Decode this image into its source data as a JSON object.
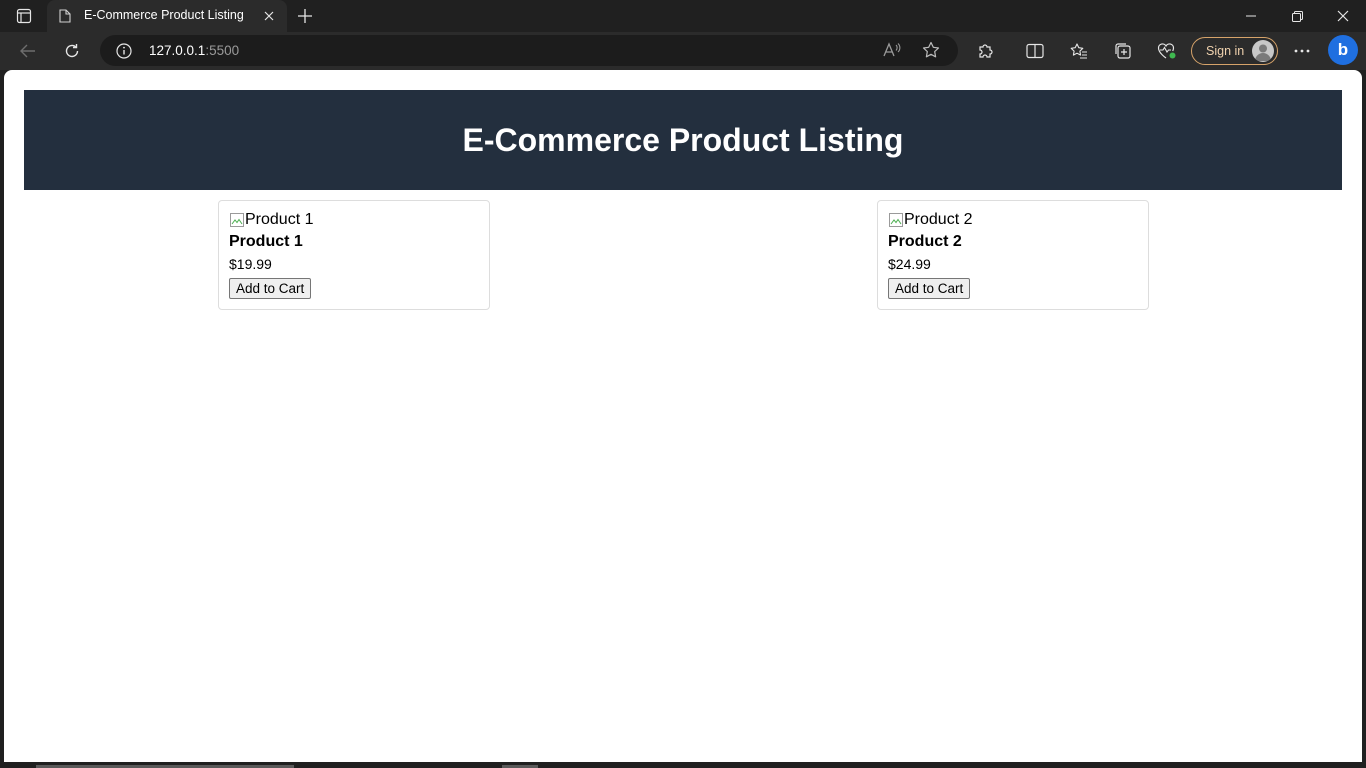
{
  "browser": {
    "tab_title": "E-Commerce Product Listing",
    "address": {
      "host": "127.0.0.1",
      "port": ":5500"
    },
    "sign_in_label": "Sign in",
    "bing_label": "b"
  },
  "page": {
    "heading": "E-Commerce Product Listing",
    "products": [
      {
        "image_alt": "Product 1",
        "name": "Product 1",
        "price": "$19.99",
        "button_label": "Add to Cart"
      },
      {
        "image_alt": "Product 2",
        "name": "Product 2",
        "price": "$24.99",
        "button_label": "Add to Cart"
      }
    ]
  },
  "colors": {
    "header_bg": "#232f3e",
    "chrome_bg": "#202020",
    "sign_in_border": "#d6a36a"
  }
}
